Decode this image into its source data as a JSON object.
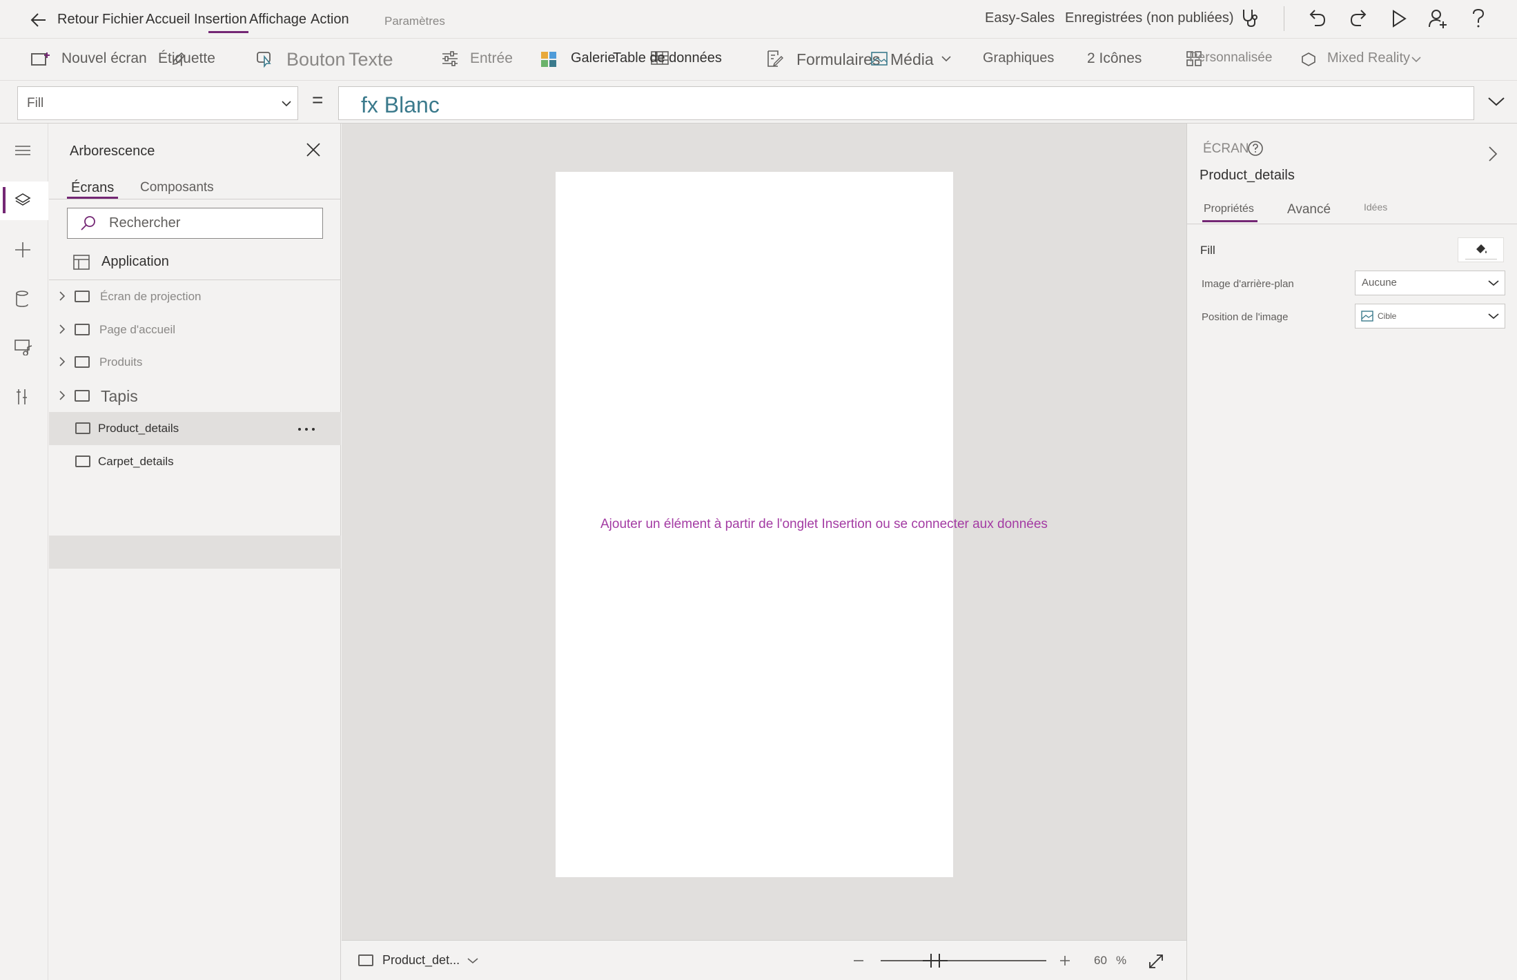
{
  "topbar": {
    "back": "Retour",
    "menus": [
      "Fichier",
      "Accueil",
      "Insertion",
      "Affichage",
      "Action"
    ],
    "settings": "Paramètres",
    "app_name": "Easy-Sales",
    "save_status": "Enregistrées (non publiées)"
  },
  "ribbon": {
    "new_screen": "Nouvel écran",
    "label": "Étiquette",
    "button": "Bouton",
    "text": "Texte",
    "input": "Entrée",
    "gallery": "Galerie",
    "data_table": "Table de données",
    "forms": "Formulaires",
    "media": "Média",
    "charts": "Graphiques",
    "icons": "2 Icônes",
    "custom": "Personnalisée",
    "mixed_reality": "Mixed Reality"
  },
  "formula": {
    "property": "Fill",
    "equals": "=",
    "expression": "fx Blanc"
  },
  "tree": {
    "title": "Arborescence",
    "tabs": [
      "Écrans",
      "Composants"
    ],
    "search_placeholder": "Rechercher",
    "app_node": "Application",
    "screens": [
      {
        "name": "Écran de projection"
      },
      {
        "name": "Page d'accueil"
      },
      {
        "name": "Produits"
      },
      {
        "name": "Tapis"
      },
      {
        "name": "Product_details"
      },
      {
        "name": "Carpet_details"
      }
    ]
  },
  "canvas": {
    "hint": "Ajouter un élément à partir de l'onglet Insertion ou se connecter aux données"
  },
  "statusbar": {
    "screen_selector": "Product_det...",
    "zoom_value": "60",
    "zoom_unit": "%"
  },
  "properties": {
    "type_label": "ÉCRAN",
    "screen_name": "Product_details",
    "tabs": [
      "Propriétés",
      "Avancé",
      "Idées"
    ],
    "fill_label": "Fill",
    "bg_image_label": "Image d'arrière-plan",
    "bg_image_value": "Aucune",
    "image_position_label": "Position de l'image",
    "image_position_value": "Cible"
  },
  "colors": {
    "accent": "#742774",
    "hint": "#a33ba3"
  }
}
